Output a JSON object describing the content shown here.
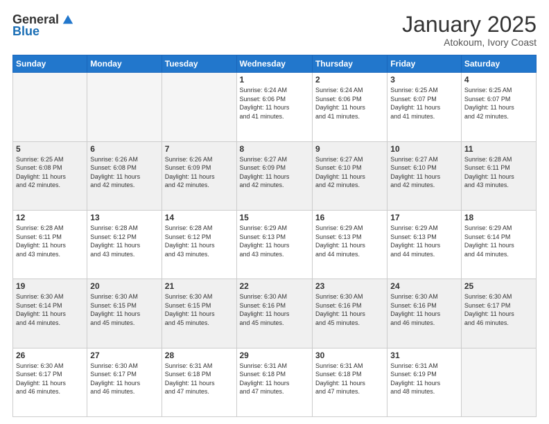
{
  "logo": {
    "general": "General",
    "blue": "Blue"
  },
  "title": "January 2025",
  "subtitle": "Atokoum, Ivory Coast",
  "days_of_week": [
    "Sunday",
    "Monday",
    "Tuesday",
    "Wednesday",
    "Thursday",
    "Friday",
    "Saturday"
  ],
  "weeks": [
    {
      "shaded": false,
      "days": [
        {
          "num": "",
          "info": ""
        },
        {
          "num": "",
          "info": ""
        },
        {
          "num": "",
          "info": ""
        },
        {
          "num": "1",
          "info": "Sunrise: 6:24 AM\nSunset: 6:06 PM\nDaylight: 11 hours\nand 41 minutes."
        },
        {
          "num": "2",
          "info": "Sunrise: 6:24 AM\nSunset: 6:06 PM\nDaylight: 11 hours\nand 41 minutes."
        },
        {
          "num": "3",
          "info": "Sunrise: 6:25 AM\nSunset: 6:07 PM\nDaylight: 11 hours\nand 41 minutes."
        },
        {
          "num": "4",
          "info": "Sunrise: 6:25 AM\nSunset: 6:07 PM\nDaylight: 11 hours\nand 42 minutes."
        }
      ]
    },
    {
      "shaded": true,
      "days": [
        {
          "num": "5",
          "info": "Sunrise: 6:25 AM\nSunset: 6:08 PM\nDaylight: 11 hours\nand 42 minutes."
        },
        {
          "num": "6",
          "info": "Sunrise: 6:26 AM\nSunset: 6:08 PM\nDaylight: 11 hours\nand 42 minutes."
        },
        {
          "num": "7",
          "info": "Sunrise: 6:26 AM\nSunset: 6:09 PM\nDaylight: 11 hours\nand 42 minutes."
        },
        {
          "num": "8",
          "info": "Sunrise: 6:27 AM\nSunset: 6:09 PM\nDaylight: 11 hours\nand 42 minutes."
        },
        {
          "num": "9",
          "info": "Sunrise: 6:27 AM\nSunset: 6:10 PM\nDaylight: 11 hours\nand 42 minutes."
        },
        {
          "num": "10",
          "info": "Sunrise: 6:27 AM\nSunset: 6:10 PM\nDaylight: 11 hours\nand 42 minutes."
        },
        {
          "num": "11",
          "info": "Sunrise: 6:28 AM\nSunset: 6:11 PM\nDaylight: 11 hours\nand 43 minutes."
        }
      ]
    },
    {
      "shaded": false,
      "days": [
        {
          "num": "12",
          "info": "Sunrise: 6:28 AM\nSunset: 6:11 PM\nDaylight: 11 hours\nand 43 minutes."
        },
        {
          "num": "13",
          "info": "Sunrise: 6:28 AM\nSunset: 6:12 PM\nDaylight: 11 hours\nand 43 minutes."
        },
        {
          "num": "14",
          "info": "Sunrise: 6:28 AM\nSunset: 6:12 PM\nDaylight: 11 hours\nand 43 minutes."
        },
        {
          "num": "15",
          "info": "Sunrise: 6:29 AM\nSunset: 6:13 PM\nDaylight: 11 hours\nand 43 minutes."
        },
        {
          "num": "16",
          "info": "Sunrise: 6:29 AM\nSunset: 6:13 PM\nDaylight: 11 hours\nand 44 minutes."
        },
        {
          "num": "17",
          "info": "Sunrise: 6:29 AM\nSunset: 6:13 PM\nDaylight: 11 hours\nand 44 minutes."
        },
        {
          "num": "18",
          "info": "Sunrise: 6:29 AM\nSunset: 6:14 PM\nDaylight: 11 hours\nand 44 minutes."
        }
      ]
    },
    {
      "shaded": true,
      "days": [
        {
          "num": "19",
          "info": "Sunrise: 6:30 AM\nSunset: 6:14 PM\nDaylight: 11 hours\nand 44 minutes."
        },
        {
          "num": "20",
          "info": "Sunrise: 6:30 AM\nSunset: 6:15 PM\nDaylight: 11 hours\nand 45 minutes."
        },
        {
          "num": "21",
          "info": "Sunrise: 6:30 AM\nSunset: 6:15 PM\nDaylight: 11 hours\nand 45 minutes."
        },
        {
          "num": "22",
          "info": "Sunrise: 6:30 AM\nSunset: 6:16 PM\nDaylight: 11 hours\nand 45 minutes."
        },
        {
          "num": "23",
          "info": "Sunrise: 6:30 AM\nSunset: 6:16 PM\nDaylight: 11 hours\nand 45 minutes."
        },
        {
          "num": "24",
          "info": "Sunrise: 6:30 AM\nSunset: 6:16 PM\nDaylight: 11 hours\nand 46 minutes."
        },
        {
          "num": "25",
          "info": "Sunrise: 6:30 AM\nSunset: 6:17 PM\nDaylight: 11 hours\nand 46 minutes."
        }
      ]
    },
    {
      "shaded": false,
      "days": [
        {
          "num": "26",
          "info": "Sunrise: 6:30 AM\nSunset: 6:17 PM\nDaylight: 11 hours\nand 46 minutes."
        },
        {
          "num": "27",
          "info": "Sunrise: 6:30 AM\nSunset: 6:17 PM\nDaylight: 11 hours\nand 46 minutes."
        },
        {
          "num": "28",
          "info": "Sunrise: 6:31 AM\nSunset: 6:18 PM\nDaylight: 11 hours\nand 47 minutes."
        },
        {
          "num": "29",
          "info": "Sunrise: 6:31 AM\nSunset: 6:18 PM\nDaylight: 11 hours\nand 47 minutes."
        },
        {
          "num": "30",
          "info": "Sunrise: 6:31 AM\nSunset: 6:18 PM\nDaylight: 11 hours\nand 47 minutes."
        },
        {
          "num": "31",
          "info": "Sunrise: 6:31 AM\nSunset: 6:19 PM\nDaylight: 11 hours\nand 48 minutes."
        },
        {
          "num": "",
          "info": ""
        }
      ]
    }
  ]
}
